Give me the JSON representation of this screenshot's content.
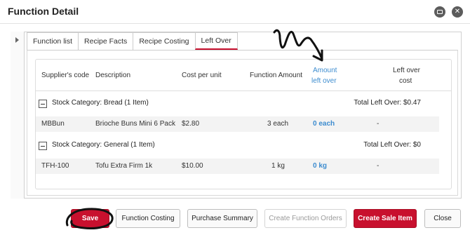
{
  "window": {
    "title": "Function Detail"
  },
  "tabs": [
    {
      "label": "Function list"
    },
    {
      "label": "Recipe Facts"
    },
    {
      "label": "Recipe Costing"
    },
    {
      "label": "Left Over"
    }
  ],
  "table": {
    "headers": {
      "supplier_code": "Supplier's code",
      "description": "Description",
      "cost_per_unit": "Cost per unit",
      "function_amount": "Function Amount",
      "amount_left_over_1": "Amount",
      "amount_left_over_2": "left over",
      "left_over_cost_1": "Left over",
      "left_over_cost_2": "cost"
    },
    "categories": [
      {
        "label": "Stock Category: Bread (1 Item)",
        "total": "Total Left Over: $0.47",
        "rows": [
          {
            "code": "MBBun",
            "description": "Brioche Buns Mini 6 Pack",
            "cost": "$2.80",
            "function_amount": "3 each",
            "left_over": "0 each",
            "left_over_cost": "-"
          }
        ]
      },
      {
        "label": "Stock Category: General (1 Item)",
        "total": "Total Left Over: $0",
        "rows": [
          {
            "code": "TFH-100",
            "description": "Tofu Extra Firm 1k",
            "cost": "$10.00",
            "function_amount": "1 kg",
            "left_over": "0 kg",
            "left_over_cost": "-"
          }
        ]
      }
    ]
  },
  "buttons": {
    "save": "Save",
    "function_costing": "Function Costing",
    "purchase_summary": "Purchase Summary",
    "create_function_orders": "Create Function Orders",
    "create_sale_item": "Create Sale Item",
    "close": "Close"
  },
  "colors": {
    "accent_red": "#c8102e",
    "link_blue": "#3d8ccf"
  },
  "icons": {
    "minimize": "minimize-icon",
    "close": "close-icon",
    "expand": "chevron-right-icon",
    "collapse": "minus-icon"
  }
}
